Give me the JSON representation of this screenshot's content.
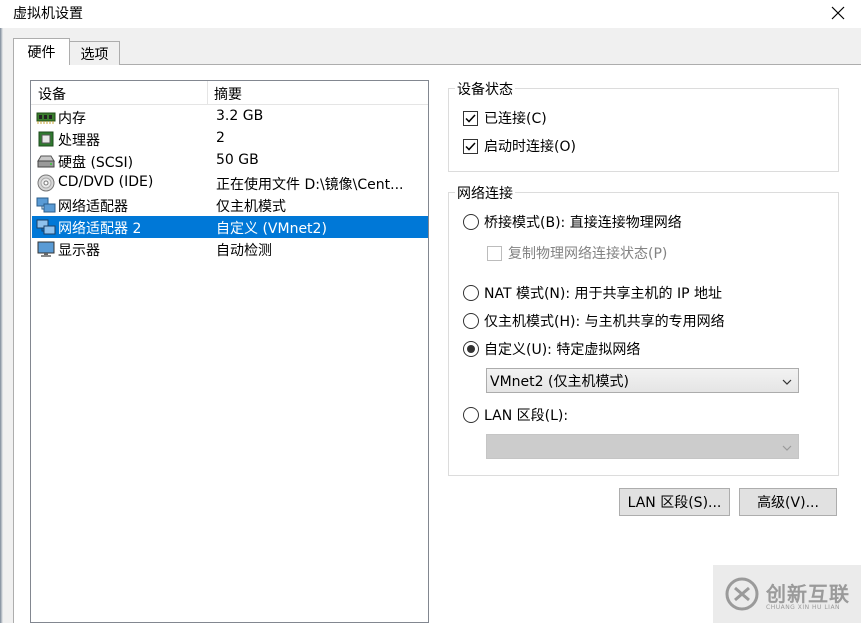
{
  "window": {
    "title": "虚拟机设置"
  },
  "tabs": [
    {
      "label": "硬件",
      "active": true
    },
    {
      "label": "选项",
      "active": false
    }
  ],
  "device_list": {
    "columns": [
      "设备",
      "摘要"
    ],
    "rows": [
      {
        "icon": "memory-icon",
        "name": "内存",
        "summary": "3.2 GB",
        "selected": false
      },
      {
        "icon": "processor-icon",
        "name": "处理器",
        "summary": "2",
        "selected": false
      },
      {
        "icon": "hard-disk-icon",
        "name": "硬盘 (SCSI)",
        "summary": "50 GB",
        "selected": false
      },
      {
        "icon": "cd-dvd-icon",
        "name": "CD/DVD (IDE)",
        "summary": "正在使用文件 D:\\镜像\\Cent...",
        "selected": false
      },
      {
        "icon": "network-adapter-icon",
        "name": "网络适配器",
        "summary": "仅主机模式",
        "selected": false
      },
      {
        "icon": "network-adapter-icon",
        "name": "网络适配器 2",
        "summary": "自定义 (VMnet2)",
        "selected": true
      },
      {
        "icon": "display-icon",
        "name": "显示器",
        "summary": "自动检测",
        "selected": false
      }
    ]
  },
  "device_status": {
    "title": "设备状态",
    "connected": {
      "label": "已连接(C)",
      "checked": true
    },
    "connect_at_power_on": {
      "label": "启动时连接(O)",
      "checked": true
    }
  },
  "network_connection": {
    "title": "网络连接",
    "bridged": {
      "label": "桥接模式(B): 直接连接物理网络",
      "checked": false
    },
    "replicate": {
      "label": "复制物理网络连接状态(P)",
      "checked": false,
      "enabled": false
    },
    "nat": {
      "label": "NAT 模式(N): 用于共享主机的 IP 地址",
      "checked": false
    },
    "host_only": {
      "label": "仅主机模式(H): 与主机共享的专用网络",
      "checked": false
    },
    "custom": {
      "label": "自定义(U): 特定虚拟网络",
      "checked": true
    },
    "custom_select_value": "VMnet2 (仅主机模式)",
    "lan_segment": {
      "label": "LAN 区段(L):",
      "checked": false
    },
    "lan_select_value": ""
  },
  "buttons": {
    "lan_segments": "LAN 区段(S)...",
    "advanced": "高级(V)..."
  },
  "watermark": {
    "text": "创新互联",
    "sub": "CHUANG XIN HU LIAN"
  },
  "colors": {
    "selection": "#0078d7",
    "dialog_bg": "#f0f0f0"
  }
}
